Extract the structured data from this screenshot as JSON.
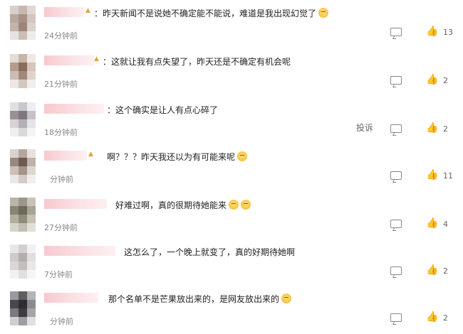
{
  "comments": [
    {
      "text": "：昨天新闻不是说她不确定能不能说，难道是我出现幻觉了",
      "emoji": "astonished-emoji",
      "time": "24分钟前",
      "likes": "13",
      "vip": true
    },
    {
      "text": "：这就让我有点失望了，昨天还是不确定有机会呢",
      "emoji": "",
      "time": "21分钟前",
      "likes": "2",
      "vip": true
    },
    {
      "text": "：这个确实是让人有点心碎了",
      "emoji": "",
      "time": "18分钟前",
      "likes": "2",
      "vip": false,
      "report": "投诉"
    },
    {
      "text": "啊？？？昨天我还以为有可能来呢",
      "emoji": "crying-emoji",
      "time": "分钟前",
      "likes": "11",
      "vip": true
    },
    {
      "text": "好难过啊，真的很期待她能来",
      "emoji": "crying-emoji crying-emoji",
      "time": "27分钟前",
      "likes": "4",
      "vip": false
    },
    {
      "text": "这怎么了，一个晚上就变了，真的好期待她啊",
      "emoji": "",
      "time": "7分钟前",
      "likes": "2",
      "vip": false
    },
    {
      "text": "那个名单不是芒果放出来的，是网友放出来的",
      "emoji": "winking-emoji",
      "time": "分钟前",
      "likes": "2",
      "vip": false
    }
  ]
}
